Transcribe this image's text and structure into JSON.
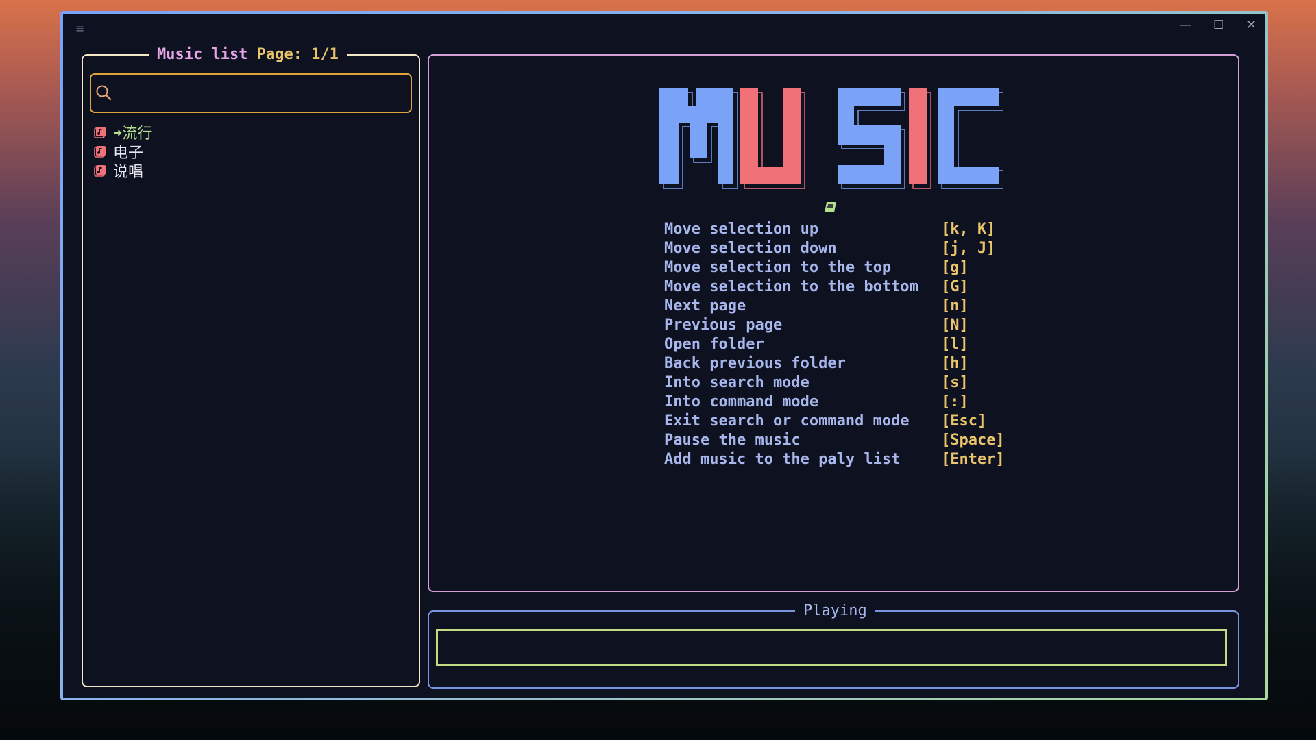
{
  "window": {
    "menu_icon": "≡",
    "minimize_icon": "—",
    "maximize_icon": "☐",
    "close_icon": "✕"
  },
  "music_list": {
    "title": "Music list",
    "page_label": "Page: 1/1",
    "search": {
      "value": "",
      "placeholder": ""
    },
    "items": [
      {
        "label": "流行",
        "selected": true,
        "marker": "➜"
      },
      {
        "label": "电子",
        "selected": false,
        "marker": ""
      },
      {
        "label": "说唱",
        "selected": false,
        "marker": ""
      }
    ]
  },
  "main": {
    "logo_text": "MUSIC",
    "book_icon": "book-icon",
    "keybindings": [
      {
        "desc": "Move selection up",
        "key": "[k, K]"
      },
      {
        "desc": "Move selection down",
        "key": "[j, J]"
      },
      {
        "desc": "Move selection to the top",
        "key": "[g]"
      },
      {
        "desc": "Move selection to the bottom",
        "key": "[G]"
      },
      {
        "desc": "Next page",
        "key": "[n]"
      },
      {
        "desc": "Previous page",
        "key": "[N]"
      },
      {
        "desc": "Open folder",
        "key": "[l]"
      },
      {
        "desc": "Back previous folder",
        "key": "[h]"
      },
      {
        "desc": "Into search mode",
        "key": "[s]"
      },
      {
        "desc": "Into command mode",
        "key": "[:]"
      },
      {
        "desc": "Exit search or command mode",
        "key": "[Esc]"
      },
      {
        "desc": "Pause the music",
        "key": "[Space]"
      },
      {
        "desc": "Add music to the paly list",
        "key": "[Enter]"
      }
    ]
  },
  "playing": {
    "title": "Playing",
    "progress": 0
  },
  "colors": {
    "pane_left": "#f3e7c8",
    "pane_main": "#d49fd6",
    "pane_playing": "#7896dd",
    "accent_yellow": "#e9c46a",
    "accent_pink": "#e7a6e8",
    "logo_blue": "#7aa2f7",
    "logo_red": "#f07178",
    "progress_green": "#c2dc86"
  }
}
